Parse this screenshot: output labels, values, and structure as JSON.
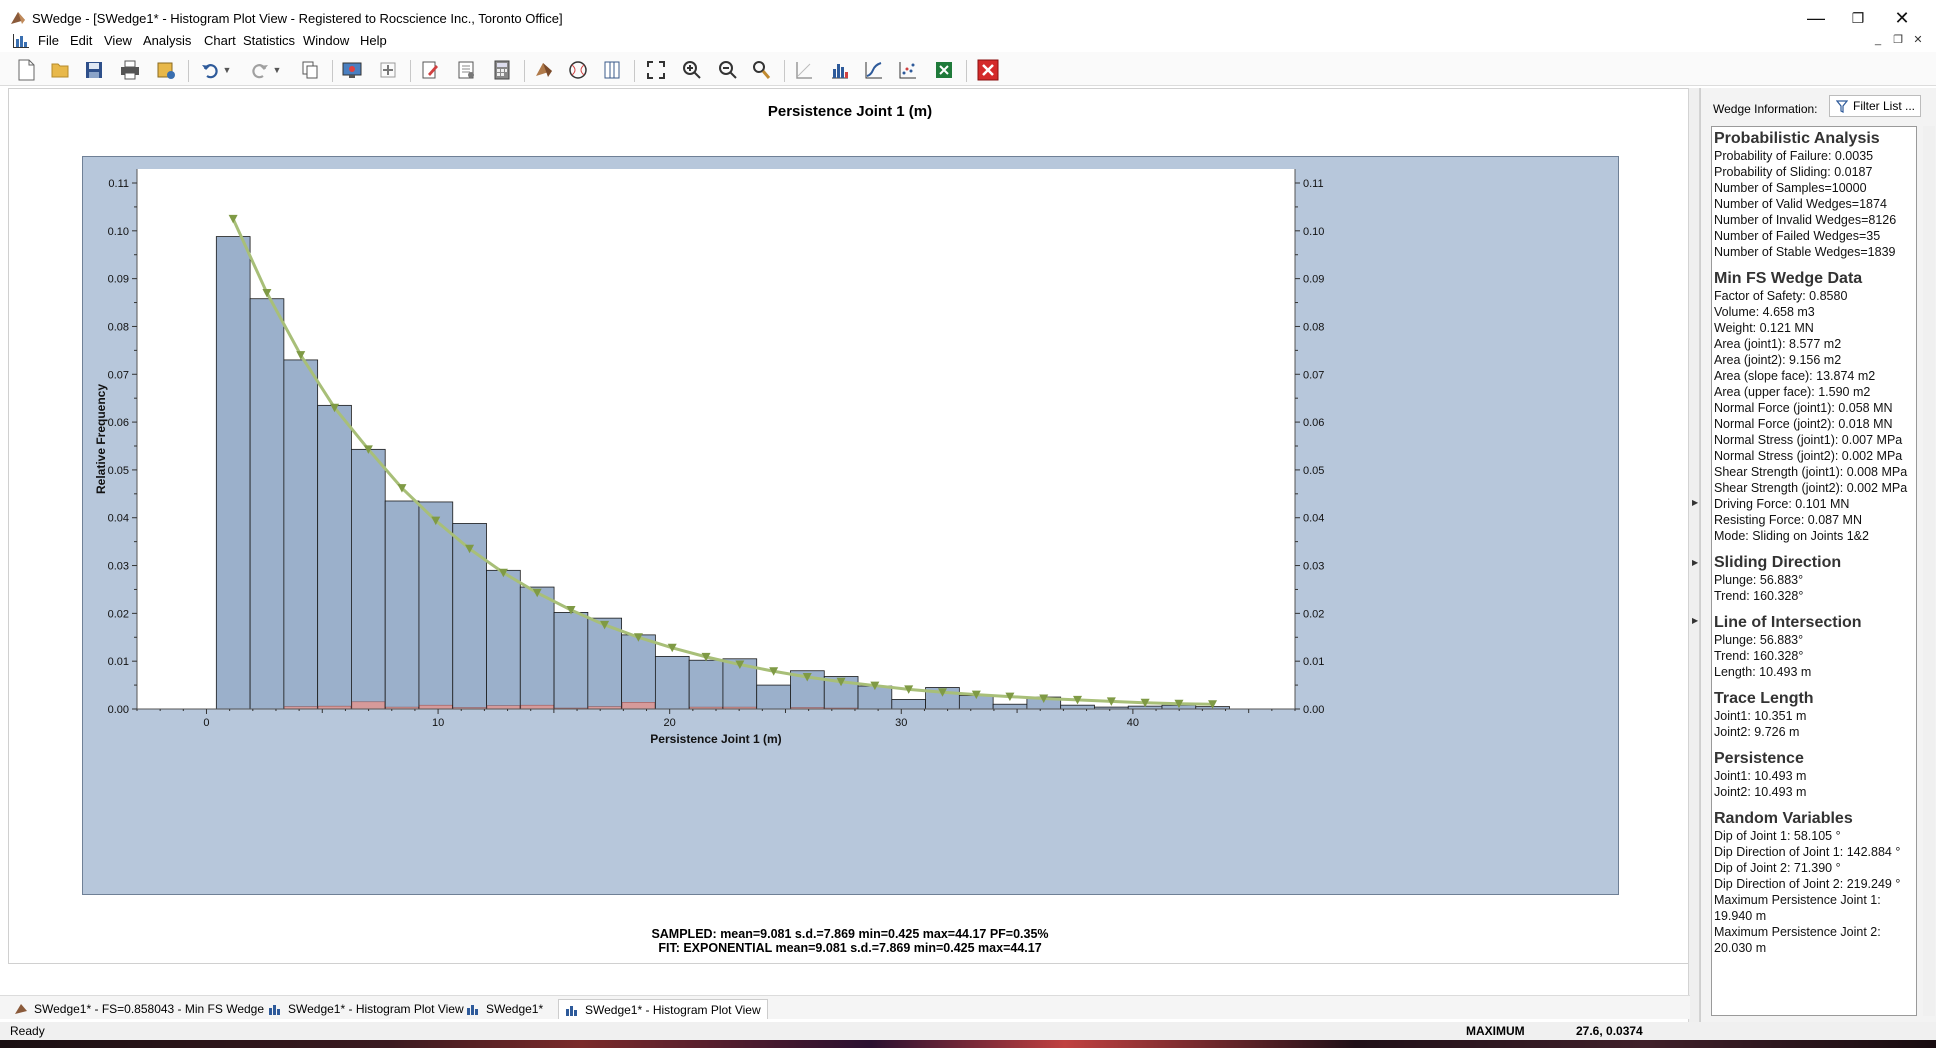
{
  "window": {
    "title": "SWedge - [SWedge1* - Histogram Plot View - Registered to Rocscience Inc., Toronto Office]",
    "minimize_glyph": "—",
    "restore_glyph": "❐",
    "close_glyph": "✕",
    "mdi_minimize_glyph": "_",
    "mdi_restore_glyph": "❐",
    "mdi_close_glyph": "✕"
  },
  "menu": [
    "File",
    "Edit",
    "View",
    "Analysis",
    "Chart",
    "Statistics",
    "Window",
    "Help"
  ],
  "toolbar_icons": [
    "new-file-icon",
    "open-folder-icon",
    "save-icon",
    "print-icon",
    "export-image-icon",
    "undo-icon",
    "redo-icon",
    "copy-icon",
    "render-icon",
    "add-icon",
    "edit-icon",
    "properties-icon",
    "calculator-icon",
    "wedge-icon",
    "stereonet-icon",
    "split-view-icon",
    "zoom-extents-icon",
    "zoom-in-icon",
    "zoom-out-icon",
    "pan-icon",
    "axes-icon",
    "histogram-icon",
    "cumulative-icon",
    "scatter-icon",
    "excel-export-icon",
    "close-view-icon"
  ],
  "chart": {
    "title": "Persistence Joint 1 (m)",
    "xlabel": "Persistence Joint 1 (m)",
    "ylabel": "Relative Frequency",
    "stats_line1": "SAMPLED: mean=9.081 s.d.=7.869 min=0.425 max=44.17 PF=0.35%",
    "stats_line2": "FIT: EXPONENTIAL mean=9.081 s.d.=7.869 min=0.425 max=44.17"
  },
  "chart_data": {
    "type": "bar",
    "xlim": [
      -3,
      47
    ],
    "ylim": [
      0,
      0.11
    ],
    "xticks": [
      0,
      10,
      20,
      30,
      40
    ],
    "yticks": [
      0.0,
      0.01,
      0.02,
      0.03,
      0.04,
      0.05,
      0.06,
      0.07,
      0.08,
      0.09,
      0.1,
      0.11
    ],
    "ytick_labels": [
      "0.00",
      "0.01",
      "0.02",
      "0.03",
      "0.04",
      "0.05",
      "0.06",
      "0.07",
      "0.08",
      "0.09",
      "0.10",
      "0.11"
    ],
    "bin_start": 0.425,
    "bin_width": 1.4583,
    "sampled": [
      0.0988,
      0.0858,
      0.073,
      0.0635,
      0.0543,
      0.0435,
      0.0433,
      0.0388,
      0.029,
      0.0255,
      0.0202,
      0.019,
      0.0155,
      0.011,
      0.0102,
      0.0105,
      0.005,
      0.008,
      0.0068,
      0.0048,
      0.002,
      0.0045,
      0.0028,
      0.001,
      0.0025,
      0.0008,
      0.0004,
      0.0006,
      0.0008,
      0.0005
    ],
    "failed": [
      0.0,
      0.0,
      0.0005,
      0.0006,
      0.0015,
      0.0004,
      0.0008,
      0.0003,
      0.0007,
      0.0008,
      0.0002,
      0.0005,
      0.0014,
      0.0,
      0.0004,
      0.0004,
      0.0,
      0.0003,
      0.0002,
      0.0,
      0.0,
      0.0,
      0.0,
      0.0,
      0.0,
      0.0,
      0.0,
      0.0,
      0.0,
      0.0
    ],
    "fit": {
      "name": "EXPONENTIAL",
      "x": [
        1.15,
        2.61,
        4.07,
        5.53,
        6.99,
        8.44,
        9.9,
        11.36,
        12.82,
        14.28,
        15.74,
        17.19,
        18.65,
        20.11,
        21.57,
        23.03,
        24.49,
        25.94,
        27.4,
        28.86,
        30.32,
        31.78,
        33.24,
        34.69,
        36.15,
        37.61,
        39.07,
        40.53,
        41.99,
        43.44
      ],
      "y": [
        0.1025,
        0.087,
        0.074,
        0.063,
        0.0543,
        0.0462,
        0.0394,
        0.0335,
        0.0285,
        0.0243,
        0.0207,
        0.0176,
        0.015,
        0.0128,
        0.0109,
        0.0093,
        0.0079,
        0.0067,
        0.0057,
        0.0049,
        0.0041,
        0.0035,
        0.003,
        0.0026,
        0.0022,
        0.0019,
        0.0016,
        0.0013,
        0.0011,
        0.001
      ]
    },
    "colors": {
      "bars": "#9bb0cb",
      "failed": "#d69a9a",
      "fit_line": "#a8bf78",
      "fit_marker": "#7f9a45",
      "background": "#b7c7db"
    },
    "grid": false
  },
  "right_panel": {
    "header": "Wedge Information:",
    "filter_button": "Filter List ...",
    "sections": [
      {
        "title": "Probabilistic Analysis",
        "lines": [
          "Probability of Failure: 0.0035",
          "Probability of Sliding: 0.0187",
          "Number of Samples=10000",
          "Number of Valid Wedges=1874",
          "Number of Invalid Wedges=8126",
          "Number of Failed Wedges=35",
          "Number of Stable Wedges=1839"
        ]
      },
      {
        "title": "Min FS Wedge Data",
        "lines": [
          "Factor of Safety: 0.8580",
          "Volume: 4.658 m3",
          "Weight: 0.121 MN",
          "Area (joint1): 8.577 m2",
          "Area (joint2): 9.156 m2",
          "Area (slope face): 13.874 m2",
          "Area (upper face): 1.590 m2",
          "Normal Force (joint1): 0.058 MN",
          "Normal Force (joint2): 0.018 MN",
          "Normal Stress (joint1): 0.007 MPa",
          "Normal Stress (joint2): 0.002 MPa",
          "Shear Strength (joint1): 0.008 MPa",
          "Shear Strength (joint2): 0.002 MPa",
          "Driving Force: 0.101 MN",
          "Resisting Force: 0.087 MN",
          "Mode: Sliding on Joints 1&2"
        ]
      },
      {
        "title": "Sliding Direction",
        "lines": [
          "Plunge: 56.883°",
          "Trend: 160.328°"
        ]
      },
      {
        "title": "Line of Intersection",
        "lines": [
          "Plunge: 56.883°",
          "Trend: 160.328°",
          "Length: 10.493 m"
        ]
      },
      {
        "title": "Trace Length",
        "lines": [
          "Joint1: 10.351 m",
          "Joint2: 9.726 m"
        ]
      },
      {
        "title": "Persistence",
        "lines": [
          "Joint1: 10.493 m",
          "Joint2: 10.493 m"
        ]
      },
      {
        "title": "Random Variables",
        "lines": [
          "Dip of Joint 1: 58.105 °",
          "Dip Direction of Joint 1: 142.884 °",
          "Dip of Joint 2: 71.390 °",
          "Dip Direction of Joint 2: 219.249 °",
          "Maximum Persistence Joint 1: 19.940 m",
          "Maximum Persistence Joint 2: 20.030 m"
        ]
      }
    ]
  },
  "tabs": [
    {
      "label": "SWedge1* - FS=0.858043 - Min FS Wedge",
      "icon": "wedge-icon"
    },
    {
      "label": "SWedge1* - Histogram Plot View",
      "icon": "histogram-icon"
    },
    {
      "label": "SWedge1*",
      "icon": "histogram-icon"
    },
    {
      "label": "SWedge1* - Histogram Plot View",
      "icon": "histogram-icon"
    }
  ],
  "status": {
    "ready": "Ready",
    "label": "MAXIMUM",
    "value": "27.6, 0.0374"
  }
}
